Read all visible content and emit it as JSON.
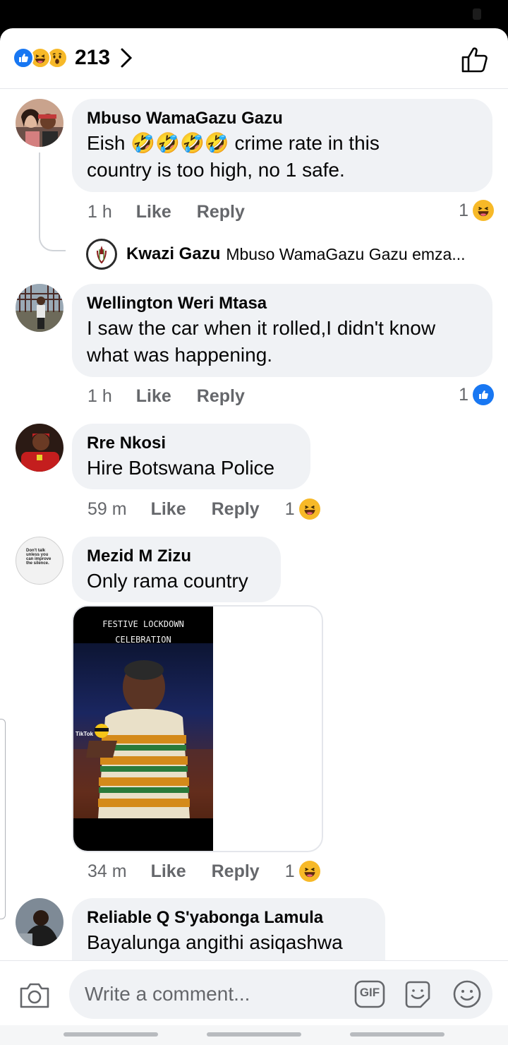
{
  "header": {
    "reaction_icons": [
      "like-icon",
      "haha-icon",
      "wow-icon"
    ],
    "reaction_count": "213"
  },
  "comments": [
    {
      "author": "Mbuso WamaGazu Gazu",
      "text_lines": [
        "Eish 🤣🤣🤣🤣 crime rate in this",
        "country is too high, no 1 safe."
      ],
      "time": "1 h",
      "like_label": "Like",
      "reply_label": "Reply",
      "reaction_count": "1",
      "reaction": "haha",
      "reply_preview": {
        "author": "Kwazi Gazu",
        "snippet": "Mbuso WamaGazu Gazu emza..."
      }
    },
    {
      "author": "Wellington Weri Mtasa",
      "text_lines": [
        "I saw the car when it rolled,I didn't know",
        "what was happening."
      ],
      "time": "1 h",
      "like_label": "Like",
      "reply_label": "Reply",
      "reaction_count": "1",
      "reaction": "like"
    },
    {
      "author": "Rre Nkosi",
      "text_lines": [
        "Hire Botswana Police"
      ],
      "time": "59 m",
      "like_label": "Like",
      "reply_label": "Reply",
      "reaction_count": "1",
      "reaction": "haha"
    },
    {
      "author": "Mezid M Zizu",
      "text_lines": [
        "Only rama country"
      ],
      "avatar_text": [
        "Don't talk",
        "unless you",
        "can improve",
        "the silence."
      ],
      "media_caption": [
        "FESTIVE LOCKDOWN",
        "CELEBRATION"
      ],
      "media_watermark": "TikTok",
      "time": "34 m",
      "like_label": "Like",
      "reply_label": "Reply",
      "reaction_count": "1",
      "reaction": "haha"
    },
    {
      "author": "Reliable Q S'yabonga Lamula",
      "text_lines": [
        "Bayalunga angithi asiqashwa"
      ]
    }
  ],
  "composer": {
    "placeholder": "Write a comment...",
    "gif_label": "GIF"
  },
  "colors": {
    "accent": "#1877f2",
    "haha": "#f7b928",
    "bubble": "#f0f2f5",
    "meta": "#65676b"
  }
}
